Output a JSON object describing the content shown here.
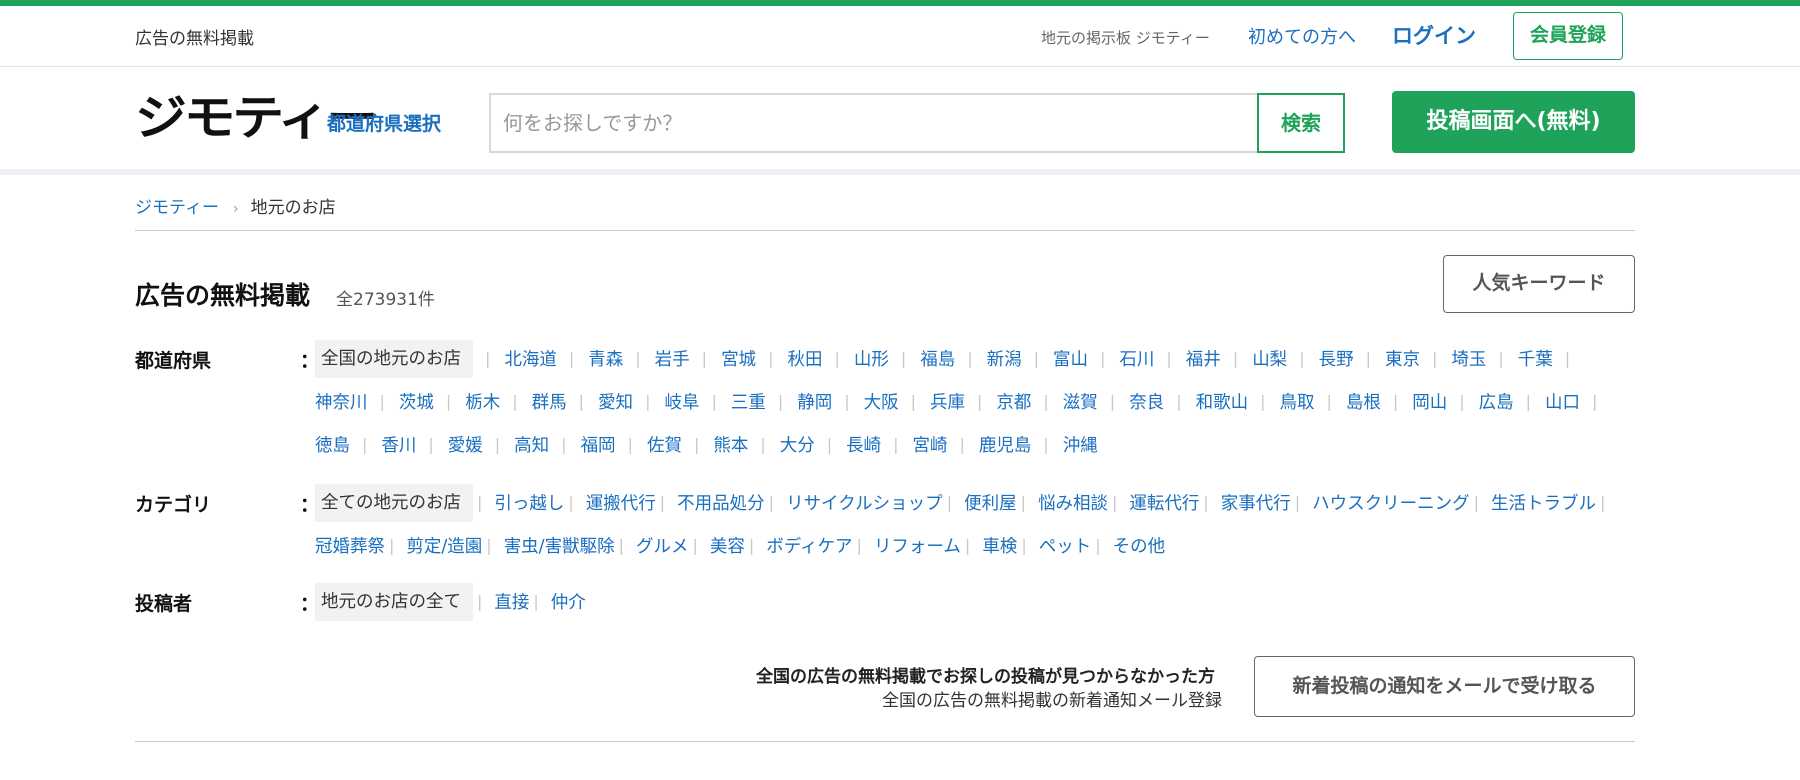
{
  "utility": {
    "left_text": "広告の無料掲載",
    "site_name": "地元の掲示板 ジモティー",
    "first_time": "初めての方へ",
    "login": "ログイン",
    "register": "会員登録"
  },
  "header": {
    "logo": "ジモティー",
    "pref_select": "都道府県選択",
    "search_placeholder": "何をお探しですか？",
    "search_button": "検索",
    "post_button": "投稿画面へ(無料)"
  },
  "breadcrumb": {
    "home": "ジモティー",
    "separator": "›",
    "current": "地元のお店"
  },
  "title": {
    "text": "広告の無料掲載",
    "count": "全273931件",
    "keyword_button": "人気キーワード"
  },
  "filters": {
    "prefecture": {
      "label": "都道府県",
      "colon": "：",
      "selected": "全国の地元のお店",
      "items": [
        "北海道",
        "青森",
        "岩手",
        "宮城",
        "秋田",
        "山形",
        "福島",
        "新潟",
        "富山",
        "石川",
        "福井",
        "山梨",
        "長野",
        "東京",
        "埼玉",
        "千葉",
        "神奈川",
        "茨城",
        "栃木",
        "群馬",
        "愛知",
        "岐阜",
        "三重",
        "静岡",
        "大阪",
        "兵庫",
        "京都",
        "滋賀",
        "奈良",
        "和歌山",
        "鳥取",
        "島根",
        "岡山",
        "広島",
        "山口",
        "徳島",
        "香川",
        "愛媛",
        "高知",
        "福岡",
        "佐賀",
        "熊本",
        "大分",
        "長崎",
        "宮崎",
        "鹿児島",
        "沖縄"
      ]
    },
    "category": {
      "label": "カテゴリ",
      "colon": "：",
      "selected": "全ての地元のお店",
      "items": [
        "引っ越し",
        "運搬代行",
        "不用品処分",
        "リサイクルショップ",
        "便利屋",
        "悩み相談",
        "運転代行",
        "家事代行",
        "ハウスクリーニング",
        "生活トラブル",
        "冠婚葬祭",
        "剪定/造園",
        "害虫/害獣駆除",
        "グルメ",
        "美容",
        "ボディケア",
        "リフォーム",
        "車検",
        "ペット",
        "その他"
      ]
    },
    "poster": {
      "label": "投稿者",
      "colon": "：",
      "selected": "地元のお店の全て",
      "items": [
        "直接",
        "仲介"
      ]
    }
  },
  "notice": {
    "strong": "全国の広告の無料掲載でお探しの投稿が見つからなかった方",
    "sub": "全国の広告の無料掲載の新着通知メール登録",
    "button": "新着投稿の通知をメールで受け取る"
  },
  "colors": {
    "accent_green": "#1fa35a",
    "link_blue": "#1a6fc0"
  }
}
